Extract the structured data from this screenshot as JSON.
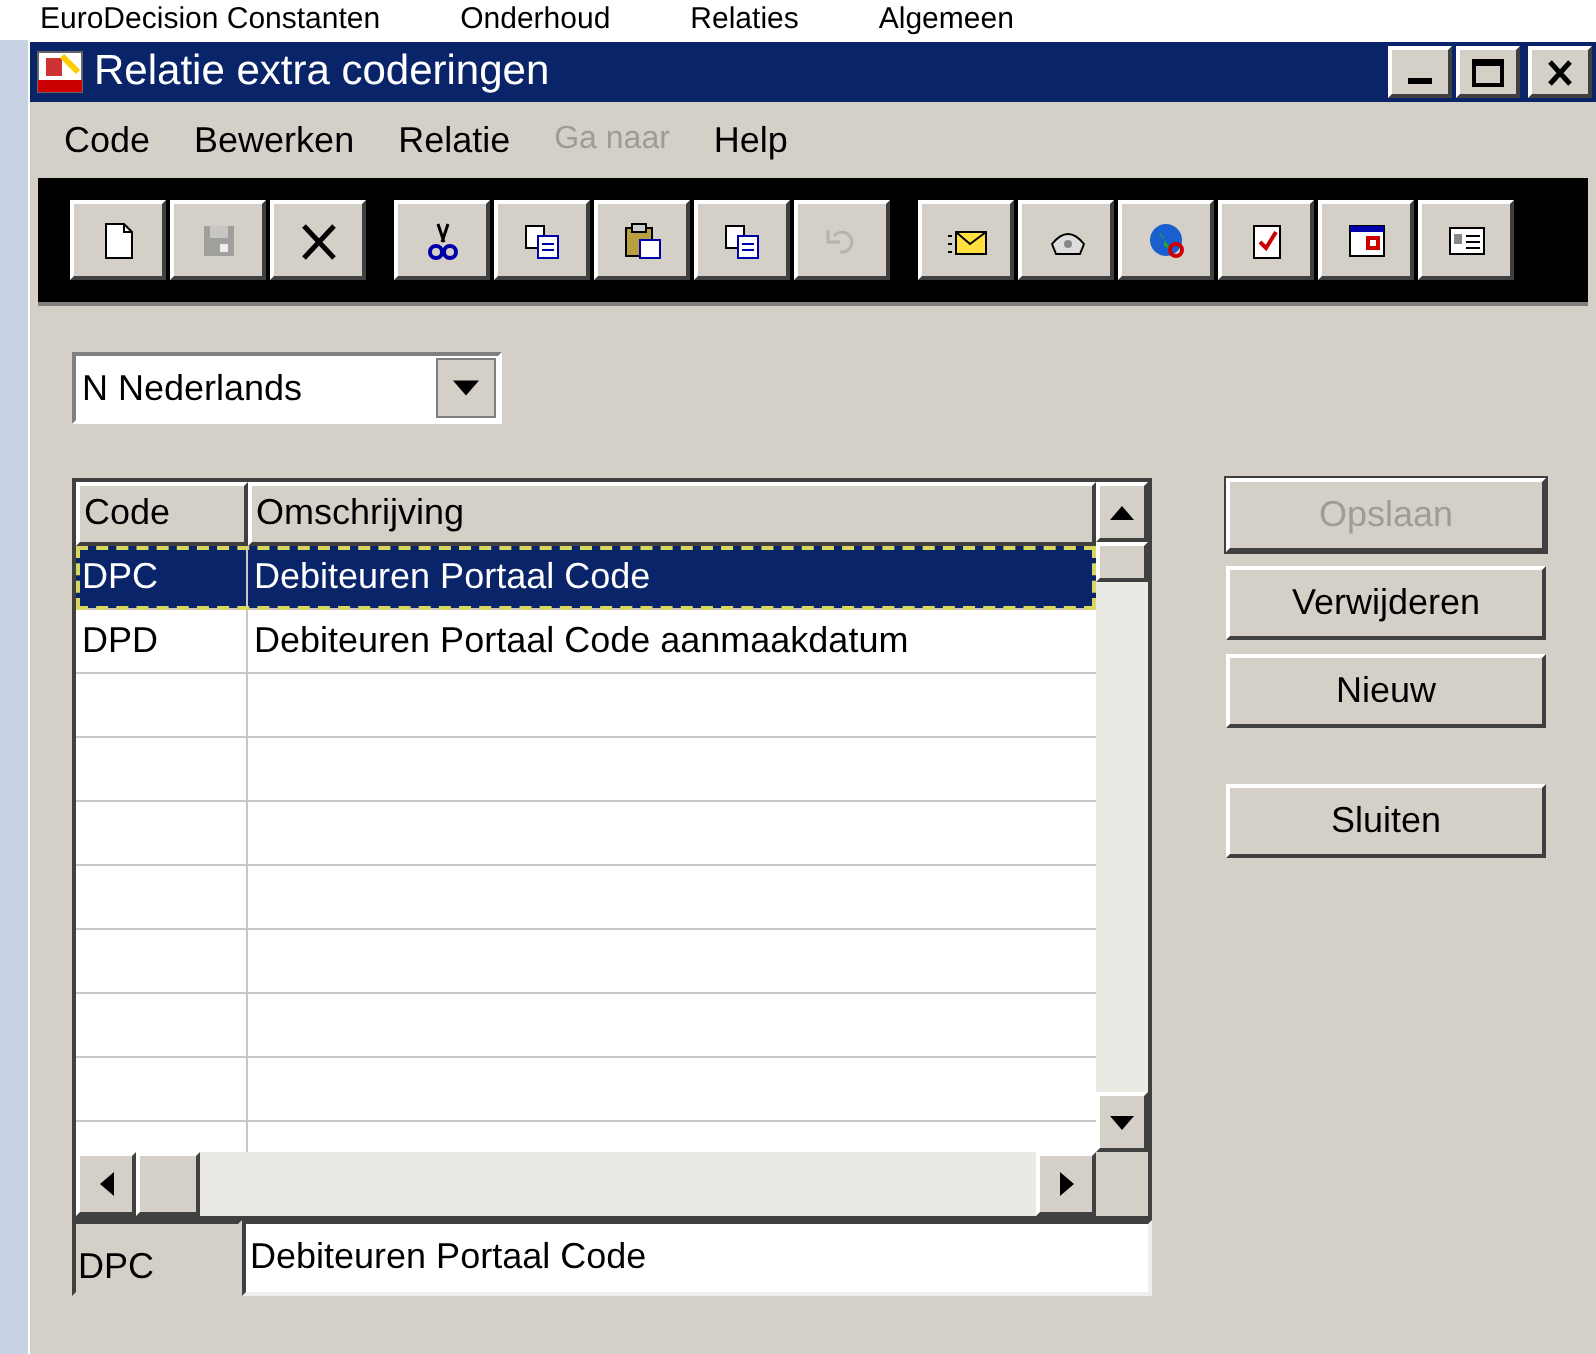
{
  "background_menu": [
    "EuroDecision Constanten",
    "Onderhoud",
    "Relaties",
    "Algemeen"
  ],
  "window": {
    "title": "Relatie extra coderingen"
  },
  "menu": [
    {
      "label": "Code",
      "disabled": false
    },
    {
      "label": "Bewerken",
      "disabled": false
    },
    {
      "label": "Relatie",
      "disabled": false
    },
    {
      "label": "Ga naar",
      "disabled": true
    },
    {
      "label": "Help",
      "disabled": false
    }
  ],
  "toolbar": [
    [
      {
        "kind": "new",
        "disabled": false
      },
      {
        "kind": "save",
        "disabled": true
      },
      {
        "kind": "delete",
        "disabled": false
      }
    ],
    [
      {
        "kind": "cut",
        "disabled": false
      },
      {
        "kind": "copy",
        "disabled": false
      },
      {
        "kind": "paste",
        "disabled": false
      },
      {
        "kind": "duplicate",
        "disabled": false
      },
      {
        "kind": "undo",
        "disabled": true
      }
    ],
    [
      {
        "kind": "mail",
        "disabled": false
      },
      {
        "kind": "phone",
        "disabled": false
      },
      {
        "kind": "globe",
        "disabled": false
      },
      {
        "kind": "task",
        "disabled": false
      },
      {
        "kind": "calendar",
        "disabled": false
      },
      {
        "kind": "card",
        "disabled": false
      }
    ]
  ],
  "language": {
    "value": "N Nederlands"
  },
  "table": {
    "columns": [
      "Code",
      "Omschrijving"
    ],
    "rows": [
      {
        "cells": [
          "DPC",
          "Debiteuren Portaal Code"
        ],
        "selected": true
      },
      {
        "cells": [
          "DPD",
          "Debiteuren Portaal Code aanmaakdatum"
        ],
        "selected": false
      }
    ]
  },
  "detail": {
    "code": "DPC",
    "description": "Debiteuren Portaal Code"
  },
  "buttons": [
    {
      "label": "Opslaan",
      "disabled": true
    },
    {
      "label": "Verwijderen",
      "disabled": false
    },
    {
      "label": "Nieuw",
      "disabled": false
    },
    {
      "label": "Sluiten",
      "disabled": false
    }
  ]
}
